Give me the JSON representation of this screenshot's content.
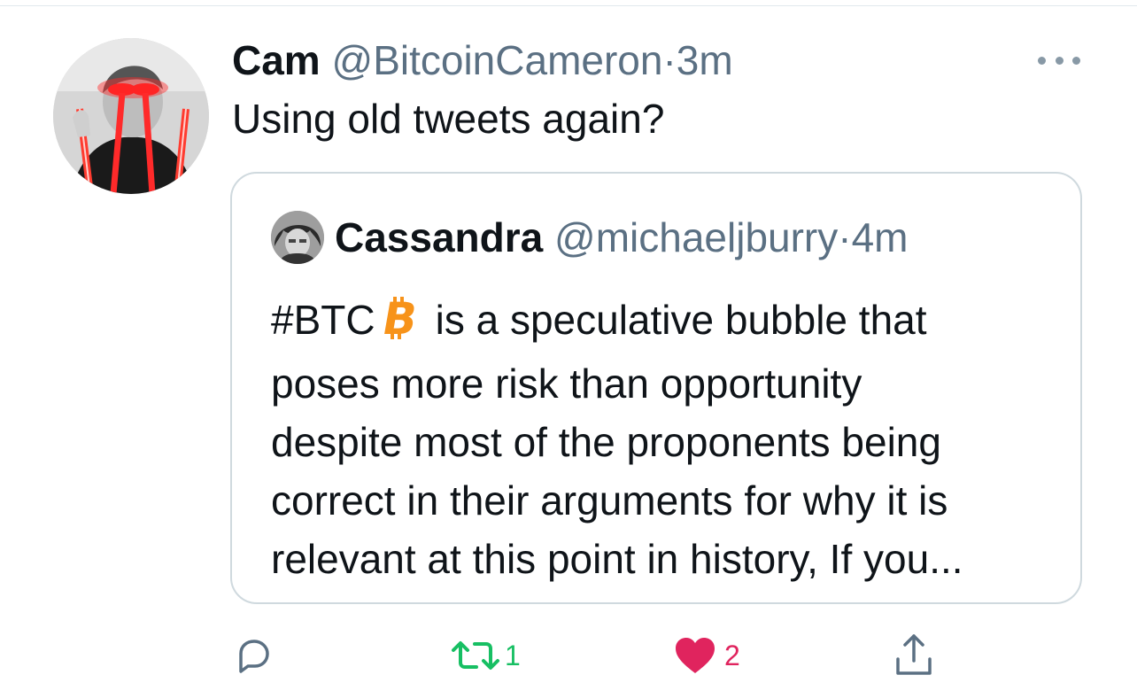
{
  "tweet": {
    "display_name": "Cam",
    "handle": "@BitcoinCameron",
    "separator": "·",
    "time": "3m",
    "text": "Using old tweets again?"
  },
  "quote": {
    "display_name": "Cassandra",
    "handle": "@michaeljburry",
    "separator": "·",
    "time": "4m",
    "hashtag": "#BTC",
    "lines": [
      "is a speculative bubble that",
      "poses more risk than opportunity",
      "despite most of the proponents being",
      "correct in their arguments for why it is",
      "relevant at this point in history, If you..."
    ]
  },
  "actions": {
    "reply_icon": "reply-icon",
    "retweet_icon": "retweet-icon",
    "retweet_count": "1",
    "like_icon": "heart-icon",
    "like_count": "2",
    "share_icon": "share-icon"
  },
  "colors": {
    "retweet_active": "#17bf63",
    "like_active": "#e0245e",
    "secondary_text": "#5b7083",
    "bitcoin_orange": "#f7931a",
    "border": "#cfd9de"
  }
}
